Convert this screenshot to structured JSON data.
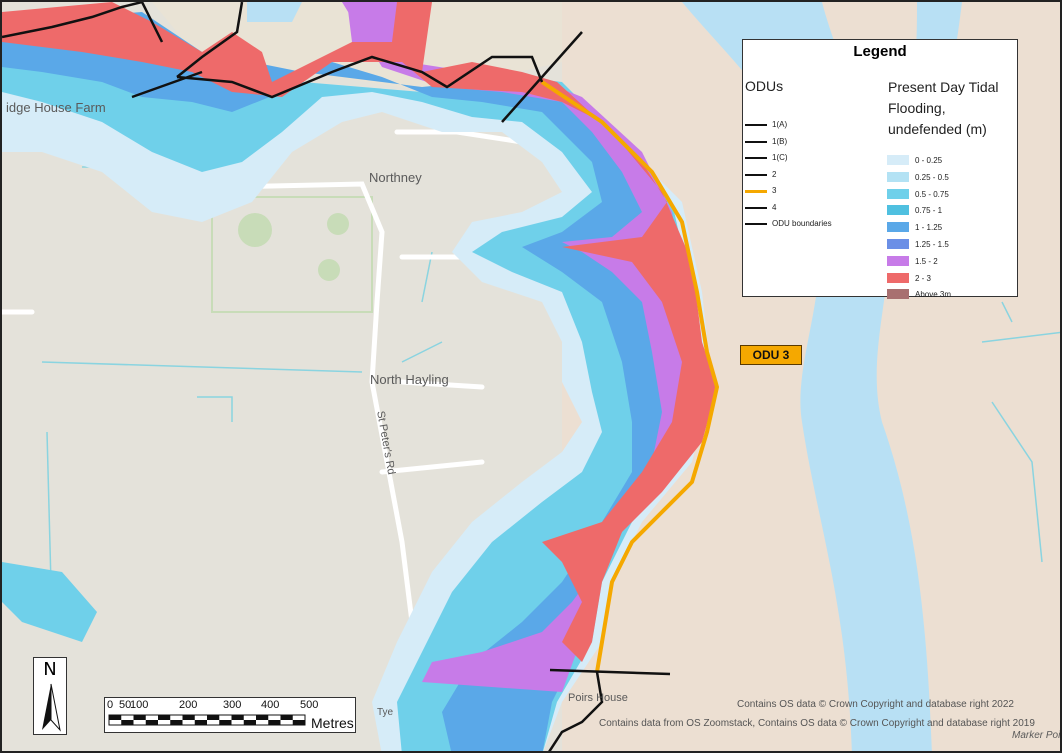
{
  "places": {
    "farm": "idge House Farm",
    "northney": "Northney",
    "north_hayling": "North Hayling",
    "road": "St Peter's Rd",
    "poirs_house": "Poirs House",
    "marker_point": "Marker Poi",
    "tye": "Tye"
  },
  "legend": {
    "title": "Legend",
    "odu_heading": "ODUs",
    "flood_heading": "Present Day Tidal Flooding, undefended (m)",
    "odus": [
      {
        "label": "1(A)",
        "color": "#111111"
      },
      {
        "label": "1(B)",
        "color": "#111111"
      },
      {
        "label": "1(C)",
        "color": "#111111"
      },
      {
        "label": "2",
        "color": "#111111"
      },
      {
        "label": "3",
        "color": "#f5a800"
      },
      {
        "label": "4",
        "color": "#111111"
      },
      {
        "label": "ODU boundaries",
        "color": "#111111"
      }
    ],
    "flood_classes": [
      {
        "label": "0 - 0.25",
        "color": "#d6ecf8"
      },
      {
        "label": "0.25  - 0.5",
        "color": "#b3e2f4"
      },
      {
        "label": "0.5 - 0.75",
        "color": "#6fd0ea"
      },
      {
        "label": "0.75 - 1",
        "color": "#4fc0e0"
      },
      {
        "label": "1 - 1.25",
        "color": "#5aa8e8"
      },
      {
        "label": "1.25 - 1.5",
        "color": "#6b8fe6"
      },
      {
        "label": "1.5 - 2",
        "color": "#c77be8"
      },
      {
        "label": "2 - 3",
        "color": "#ee6a6a"
      },
      {
        "label": "Above 3m",
        "color": "#a87070"
      }
    ]
  },
  "odu_tag": "ODU 3",
  "north_arrow": "N",
  "scale": {
    "ticks": [
      "0",
      "50",
      "100",
      "200",
      "300",
      "400",
      "500"
    ],
    "unit": "Metres"
  },
  "attribution": {
    "line1": "Contains OS data © Crown Copyright and database right 2022",
    "line2": "Contains data from OS Zoomstack, Contains OS data © Crown Copyright and database right 2019"
  },
  "colors": {
    "land": "#e4e2da",
    "water": "#b8e0f4",
    "mudflat": "#ecdfd2",
    "odu3_line": "#f5a800"
  }
}
